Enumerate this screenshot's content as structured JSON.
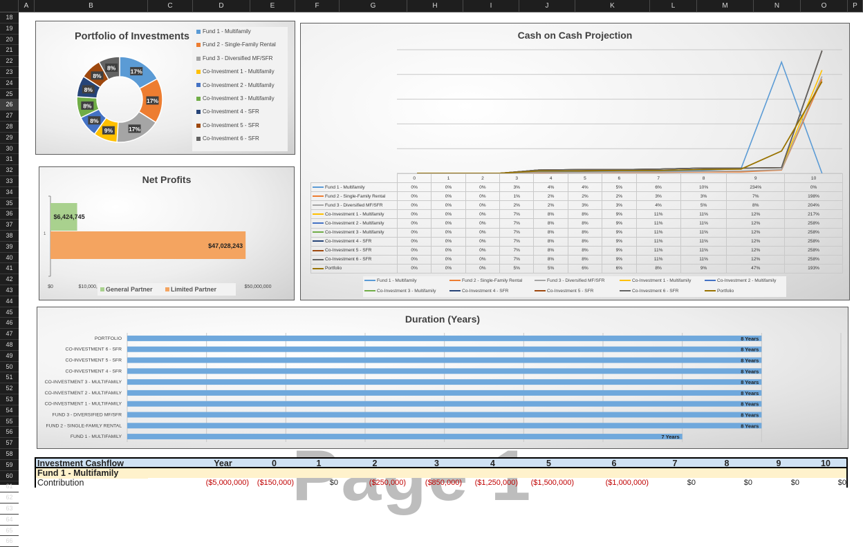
{
  "columns": [
    "A",
    "B",
    "C",
    "D",
    "E",
    "F",
    "G",
    "H",
    "I",
    "J",
    "K",
    "L",
    "M",
    "N",
    "O",
    "P"
  ],
  "rows": [
    "18",
    "19",
    "20",
    "21",
    "22",
    "23",
    "24",
    "25",
    "26",
    "27",
    "28",
    "29",
    "30",
    "31",
    "32",
    "33",
    "34",
    "35",
    "36",
    "37",
    "38",
    "39",
    "40",
    "41",
    "42",
    "43",
    "44",
    "45",
    "46",
    "47",
    "48",
    "49",
    "50",
    "51",
    "52",
    "53",
    "54",
    "55",
    "56",
    "57",
    "58",
    "59",
    "60",
    "61",
    "62",
    "63",
    "64",
    "65",
    "66"
  ],
  "selected_row": "26",
  "portfolio": {
    "title": "Portfolio of Investments",
    "slices": [
      {
        "name": "Fund 1 - Multifamily",
        "value": 17,
        "label": "17%",
        "color": "#5b9bd5"
      },
      {
        "name": "Fund 2 - Single-Family Rental",
        "value": 17,
        "label": "17%",
        "color": "#ed7d31"
      },
      {
        "name": "Fund 3 - Diversified MF/SFR",
        "value": 17,
        "label": "17%",
        "color": "#a5a5a5"
      },
      {
        "name": "Co-Investment 1 - Multifamily",
        "value": 9,
        "label": "9%",
        "color": "#ffc000"
      },
      {
        "name": "Co-Investment 2 - Multifamily",
        "value": 8,
        "label": "8%",
        "color": "#4472c4"
      },
      {
        "name": "Co-Investment 3 - Multifamily",
        "value": 8,
        "label": "8%",
        "color": "#70ad47"
      },
      {
        "name": "Co-Investment 4 - SFR",
        "value": 8,
        "label": "8%",
        "color": "#264478"
      },
      {
        "name": "Co-Investment 5 - SFR",
        "value": 8,
        "label": "8%",
        "color": "#9e480e"
      },
      {
        "name": "Co-Investment 6 - SFR",
        "value": 8,
        "label": "8%",
        "color": "#636363"
      }
    ]
  },
  "netprofits": {
    "title": "Net Profits",
    "category": "1",
    "gp": {
      "name": "General Partner",
      "value": 6424745,
      "label": "$6,424,745",
      "color": "#a9d18e"
    },
    "lp": {
      "name": "Limited Partner",
      "value": 47028243,
      "label": "$47,028,243",
      "color": "#f4a460"
    },
    "xticks": [
      "$0",
      "$10,000,000",
      "$20,000,000",
      "$30,000,000",
      "$40,000,000",
      "$50,000,000"
    ],
    "xmax": 50000000
  },
  "coc": {
    "title": "Cash on Cash Projection",
    "years": [
      "0",
      "1",
      "2",
      "3",
      "4",
      "5",
      "6",
      "7",
      "8",
      "9",
      "10"
    ],
    "series": [
      {
        "name": "Fund 1 - Multifamily",
        "color": "#5b9bd5",
        "values": [
          0,
          0,
          0,
          3,
          4,
          4,
          5,
          6,
          10,
          234,
          0
        ],
        "labels": [
          "0%",
          "0%",
          "0%",
          "3%",
          "4%",
          "4%",
          "5%",
          "6%",
          "10%",
          "234%",
          "0%"
        ]
      },
      {
        "name": "Fund 2 - Single-Family Rental",
        "color": "#ed7d31",
        "values": [
          0,
          0,
          0,
          1,
          2,
          2,
          2,
          3,
          3,
          7,
          198
        ],
        "labels": [
          "0%",
          "0%",
          "0%",
          "1%",
          "2%",
          "2%",
          "2%",
          "3%",
          "3%",
          "7%",
          "198%"
        ]
      },
      {
        "name": "Fund 3 - Diversified MF/SFR",
        "color": "#a5a5a5",
        "values": [
          0,
          0,
          0,
          2,
          2,
          3,
          3,
          4,
          5,
          8,
          204
        ],
        "labels": [
          "0%",
          "0%",
          "0%",
          "2%",
          "2%",
          "3%",
          "3%",
          "4%",
          "5%",
          "8%",
          "204%"
        ]
      },
      {
        "name": "Co-Investment 1 - Multifamily",
        "color": "#ffc000",
        "values": [
          0,
          0,
          0,
          7,
          8,
          8,
          9,
          11,
          11,
          12,
          217
        ],
        "labels": [
          "0%",
          "0%",
          "0%",
          "7%",
          "8%",
          "8%",
          "9%",
          "11%",
          "11%",
          "12%",
          "217%"
        ]
      },
      {
        "name": "Co-Investment 2 - Multifamily",
        "color": "#4472c4",
        "values": [
          0,
          0,
          0,
          7,
          8,
          8,
          9,
          11,
          11,
          12,
          258
        ],
        "labels": [
          "0%",
          "0%",
          "0%",
          "7%",
          "8%",
          "8%",
          "9%",
          "11%",
          "11%",
          "12%",
          "258%"
        ]
      },
      {
        "name": "Co-Investment 3 - Multifamily",
        "color": "#70ad47",
        "values": [
          0,
          0,
          0,
          7,
          8,
          8,
          9,
          11,
          11,
          12,
          258
        ],
        "labels": [
          "0%",
          "0%",
          "0%",
          "7%",
          "8%",
          "8%",
          "9%",
          "11%",
          "11%",
          "12%",
          "258%"
        ]
      },
      {
        "name": "Co-Investment 4 - SFR",
        "color": "#264478",
        "values": [
          0,
          0,
          0,
          7,
          8,
          8,
          9,
          11,
          11,
          12,
          258
        ],
        "labels": [
          "0%",
          "0%",
          "0%",
          "7%",
          "8%",
          "8%",
          "9%",
          "11%",
          "11%",
          "12%",
          "258%"
        ]
      },
      {
        "name": "Co-Investment 5 - SFR",
        "color": "#9e480e",
        "values": [
          0,
          0,
          0,
          7,
          8,
          8,
          9,
          11,
          11,
          12,
          258
        ],
        "labels": [
          "0%",
          "0%",
          "0%",
          "7%",
          "8%",
          "8%",
          "9%",
          "11%",
          "11%",
          "12%",
          "258%"
        ]
      },
      {
        "name": "Co-Investment 6 - SFR",
        "color": "#636363",
        "values": [
          0,
          0,
          0,
          7,
          8,
          8,
          9,
          11,
          11,
          12,
          258
        ],
        "labels": [
          "0%",
          "0%",
          "0%",
          "7%",
          "8%",
          "8%",
          "9%",
          "11%",
          "11%",
          "12%",
          "258%"
        ]
      },
      {
        "name": "Portfolio",
        "color": "#997300",
        "values": [
          0,
          0,
          0,
          5,
          5,
          6,
          6,
          8,
          9,
          47,
          193
        ],
        "labels": [
          "0%",
          "0%",
          "0%",
          "5%",
          "5%",
          "6%",
          "6%",
          "8%",
          "9%",
          "47%",
          "193%"
        ]
      }
    ],
    "ymax": 260
  },
  "duration": {
    "title": "Duration (Years)",
    "xmax": 10,
    "items": [
      {
        "name": "PORTFOLIO",
        "value": 8,
        "label": "8 Years"
      },
      {
        "name": "CO-INVESTMENT 6 - SFR",
        "value": 8,
        "label": "8 Years"
      },
      {
        "name": "CO-INVESTMENT 5 - SFR",
        "value": 8,
        "label": "8 Years"
      },
      {
        "name": "CO-INVESTMENT 4 - SFR",
        "value": 8,
        "label": "8 Years"
      },
      {
        "name": "CO-INVESTMENT 3 - MULTIFAMILY",
        "value": 8,
        "label": "8 Years"
      },
      {
        "name": "CO-INVESTMENT 2 - MULTIFAMILY",
        "value": 8,
        "label": "8 Years"
      },
      {
        "name": "CO-INVESTMENT 1 - MULTIFAMILY",
        "value": 8,
        "label": "8 Years"
      },
      {
        "name": "FUND 3 - DIVERSIFIED MF/SFR",
        "value": 8,
        "label": "8 Years"
      },
      {
        "name": "FUND 2 - SINGLE-FAMILY RENTAL",
        "value": 8,
        "label": "8 Years"
      },
      {
        "name": "FUND 1 - MULTIFAMILY",
        "value": 7,
        "label": "7 Years"
      }
    ],
    "color": "#6fa8dc"
  },
  "chart_data": [
    {
      "type": "pie",
      "title": "Portfolio of Investments",
      "categories": [
        "Fund 1 - Multifamily",
        "Fund 2 - Single-Family Rental",
        "Fund 3 - Diversified MF/SFR",
        "Co-Investment 1 - Multifamily",
        "Co-Investment 2 - Multifamily",
        "Co-Investment 3 - Multifamily",
        "Co-Investment 4 - SFR",
        "Co-Investment 5 - SFR",
        "Co-Investment 6 - SFR"
      ],
      "values": [
        17,
        17,
        17,
        9,
        8,
        8,
        8,
        8,
        8
      ]
    },
    {
      "type": "bar",
      "title": "Net Profits",
      "categories": [
        "1"
      ],
      "series": [
        {
          "name": "General Partner",
          "values": [
            6424745
          ]
        },
        {
          "name": "Limited Partner",
          "values": [
            47028243
          ]
        }
      ],
      "xlim": [
        0,
        50000000
      ]
    },
    {
      "type": "line",
      "title": "Cash on Cash Projection",
      "x": [
        0,
        1,
        2,
        3,
        4,
        5,
        6,
        7,
        8,
        9,
        10
      ]
    },
    {
      "type": "bar",
      "title": "Duration (Years)",
      "categories": [
        "PORTFOLIO",
        "CO-INVESTMENT 6 - SFR",
        "CO-INVESTMENT 5 - SFR",
        "CO-INVESTMENT 4 - SFR",
        "CO-INVESTMENT 3 - MULTIFAMILY",
        "CO-INVESTMENT 2 - MULTIFAMILY",
        "CO-INVESTMENT 1 - MULTIFAMILY",
        "FUND 3 - DIVERSIFIED MF/SFR",
        "FUND 2 - SINGLE-FAMILY RENTAL",
        "FUND 1 - MULTIFAMILY"
      ],
      "values": [
        8,
        8,
        8,
        8,
        8,
        8,
        8,
        8,
        8,
        7
      ]
    }
  ],
  "watermark": "Page 1",
  "cashflow": {
    "title": "Investment Cashflow",
    "year_label": "Year",
    "years": [
      "0",
      "1",
      "2",
      "3",
      "4",
      "5",
      "6",
      "7",
      "8",
      "9",
      "10"
    ],
    "fund_label": "Fund 1 - Multifamily",
    "contribution_label": "Contribution",
    "contribution": [
      "($5,000,000)",
      "($150,000)",
      "$0",
      "($250,000)",
      "($850,000)",
      "($1,250,000)",
      "($1,500,000)",
      "($1,000,000)",
      "$0",
      "$0",
      "$0",
      "$0"
    ]
  }
}
